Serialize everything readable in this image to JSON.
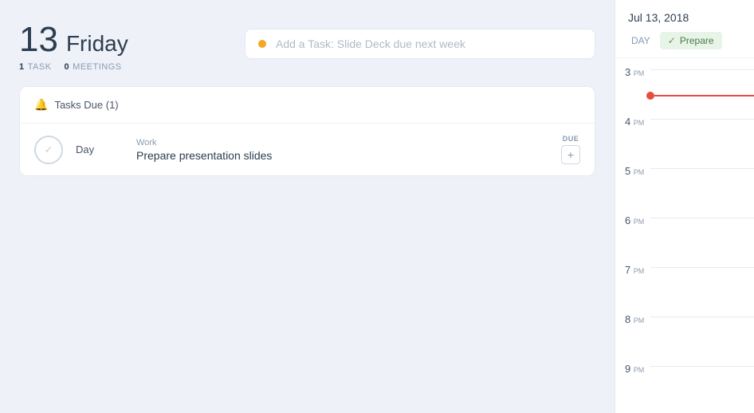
{
  "left": {
    "day_number": "13",
    "day_name": "Friday",
    "stats": {
      "task_count": "1",
      "task_label": "TASK",
      "meeting_count": "0",
      "meeting_label": "MEETINGS"
    },
    "add_task_placeholder": "Add a Task: Slide Deck due next week",
    "tasks_due_label": "Tasks Due (1)",
    "task": {
      "time": "Day",
      "category": "Work",
      "title": "Prepare presentation slides",
      "due_label": "DUE",
      "due_btn": "+"
    }
  },
  "right": {
    "date": "Jul 13, 2018",
    "tab_day": "DAY",
    "tab_prepare": "Prepare",
    "time_slots": [
      {
        "hour": "3",
        "sub": "PM"
      },
      {
        "hour": "4",
        "sub": "PM"
      },
      {
        "hour": "5",
        "sub": "PM"
      },
      {
        "hour": "6",
        "sub": "PM"
      },
      {
        "hour": "7",
        "sub": "PM"
      },
      {
        "hour": "8",
        "sub": "PM"
      },
      {
        "hour": "9",
        "sub": "PM"
      }
    ]
  },
  "icons": {
    "bell": "🔔",
    "check": "✓",
    "clock": "○"
  }
}
